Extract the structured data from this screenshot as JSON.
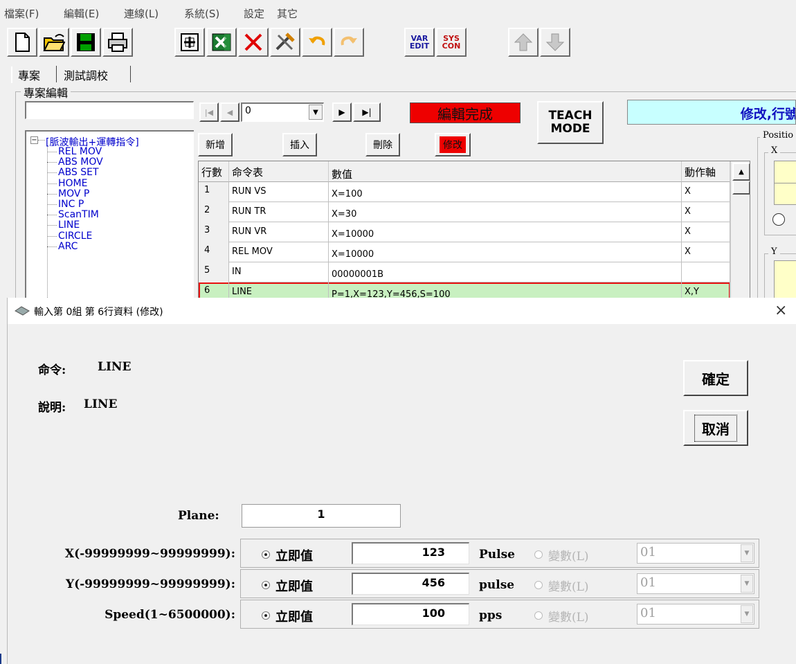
{
  "menu": [
    "檔案(F)",
    "編輯(E)",
    "連線(L)",
    "系統(S)",
    "設定",
    "其它"
  ],
  "toolbar": {
    "var_edit": [
      "VAR",
      "EDIT"
    ],
    "sys_con": [
      "SYS",
      "CON"
    ]
  },
  "tabs": [
    "專案",
    "測試調校"
  ],
  "project_group_title": "專案編輯",
  "nav": {
    "index_value": "0"
  },
  "status_label": "編輯完成",
  "teach_mode": [
    "TEACH",
    "MODE"
  ],
  "message": "修改,行號",
  "position_group_title": "Positio",
  "x_group_title": "X",
  "y_group_title": "Y",
  "buttons": {
    "add": "新增",
    "insert": "插入",
    "delete": "刪除",
    "modify": "修改"
  },
  "tree": {
    "root": "[脈波輸出+運轉指令]",
    "items": [
      "REL MOV",
      "ABS MOV",
      "ABS SET",
      "HOME",
      "MOV P",
      "INC P",
      "ScanTIM",
      "LINE",
      "CIRCLE",
      "ARC"
    ]
  },
  "grid": {
    "headers": [
      "行數",
      "命令表",
      "數值",
      "動作軸"
    ],
    "rows": [
      {
        "no": "1",
        "cmd": "RUN VS",
        "value": "X=100",
        "axis": "X"
      },
      {
        "no": "2",
        "cmd": "RUN TR",
        "value": "X=30",
        "axis": "X"
      },
      {
        "no": "3",
        "cmd": "RUN VR",
        "value": "X=10000",
        "axis": "X"
      },
      {
        "no": "4",
        "cmd": "REL MOV",
        "value": "X=10000",
        "axis": "X"
      },
      {
        "no": "5",
        "cmd": "IN",
        "value": "00000001B",
        "axis": ""
      },
      {
        "no": "6",
        "cmd": "LINE",
        "value": "P=1,X=123,Y=456,S=100",
        "axis": "X,Y"
      }
    ],
    "selected_row": 6
  },
  "dialog": {
    "title": "輸入第 0組 第 6行資料 (修改)",
    "command_label": "命令:",
    "command_value": "LINE",
    "desc_label": "說明:",
    "desc_value": "LINE",
    "ok": "確定",
    "cancel": "取消",
    "plane_label": "Plane:",
    "plane_value": "1",
    "params": [
      {
        "label": "X(-99999999~99999999):",
        "mode": "立即值",
        "value": "123",
        "unit": "Pulse",
        "var_label": "變數(L)",
        "var_value": "01"
      },
      {
        "label": "Y(-99999999~99999999):",
        "mode": "立即值",
        "value": "456",
        "unit": "pulse",
        "var_label": "變數(L)",
        "var_value": "01"
      },
      {
        "label": "Speed(1~6500000):",
        "mode": "立即值",
        "value": "100",
        "unit": "pps",
        "var_label": "變數(L)",
        "var_value": "01"
      }
    ]
  },
  "colors": {
    "status_red": "#ee0000",
    "message_bg": "#c8ffff",
    "selected_row": "#c8f0c0",
    "selected_border": "#e81010",
    "tree_text": "#0000cc"
  }
}
